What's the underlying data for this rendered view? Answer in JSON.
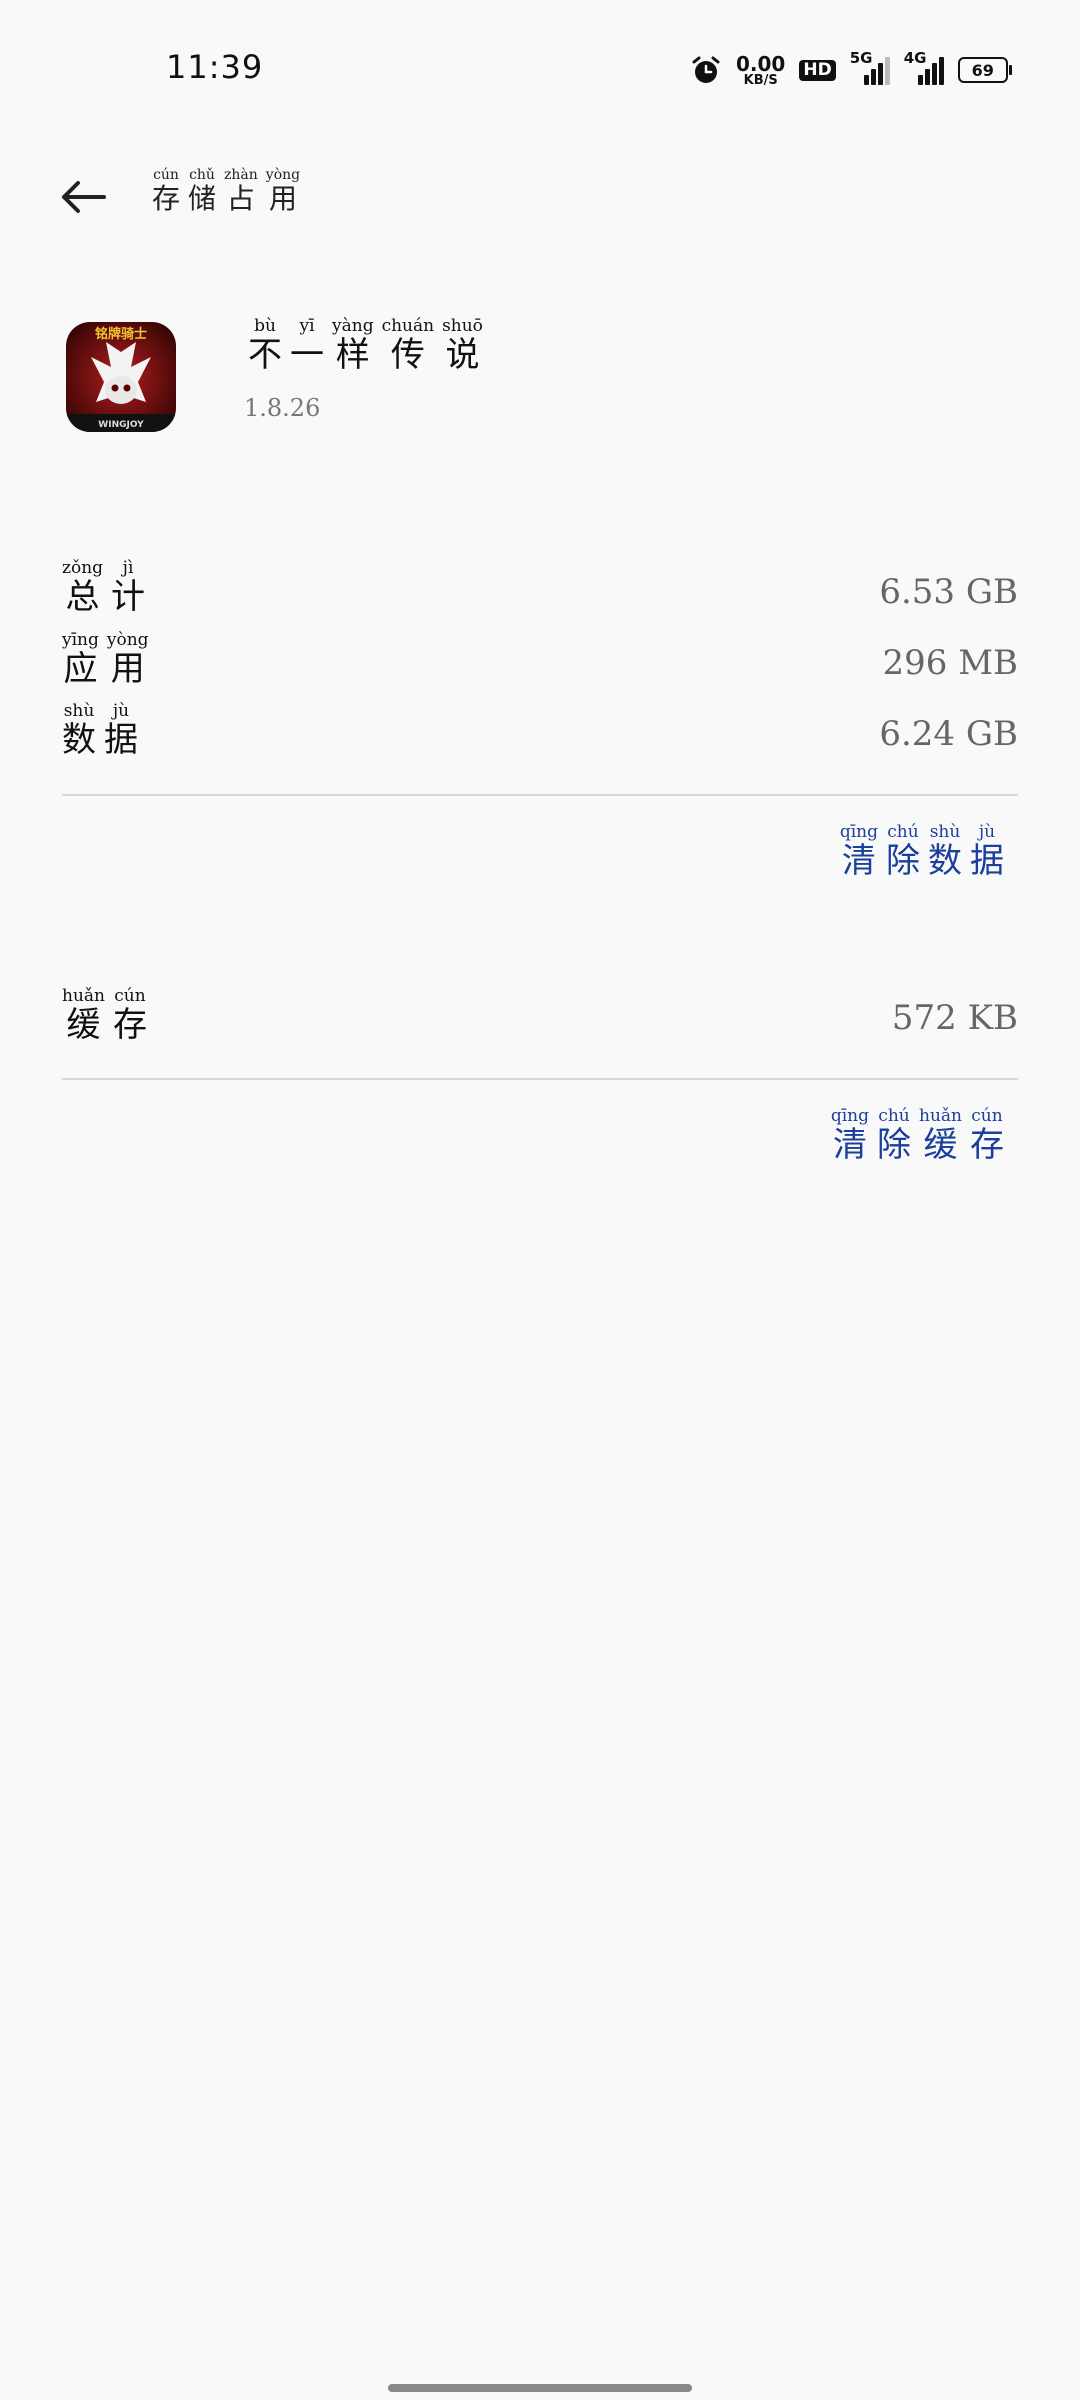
{
  "status_bar": {
    "time": "11:39",
    "net_speed_value": "0.00",
    "net_speed_unit": "KB/S",
    "hd_label": "HD",
    "signal1_label": "5G",
    "signal2_label": "4G",
    "battery": "69"
  },
  "header": {
    "title_chars": [
      {
        "char": "存",
        "pinyin": "cún"
      },
      {
        "char": "储",
        "pinyin": "chǔ"
      },
      {
        "char": "占",
        "pinyin": "zhàn"
      },
      {
        "char": "用",
        "pinyin": "yòng"
      }
    ]
  },
  "app": {
    "name_chars": [
      {
        "char": "不",
        "pinyin": "bù"
      },
      {
        "char": "一",
        "pinyin": "yī"
      },
      {
        "char": "样",
        "pinyin": "yàng"
      },
      {
        "char": "传",
        "pinyin": "chuán"
      },
      {
        "char": "说",
        "pinyin": "shuō"
      }
    ],
    "version": "1.8.26",
    "icon_text_top": "铭牌骑士",
    "icon_text_bottom": "WINGJOY"
  },
  "storage": {
    "total": {
      "label_chars": [
        {
          "char": "总",
          "pinyin": "zǒng"
        },
        {
          "char": "计",
          "pinyin": "jì"
        }
      ],
      "value": "6.53 GB"
    },
    "app": {
      "label_chars": [
        {
          "char": "应",
          "pinyin": "yīng"
        },
        {
          "char": "用",
          "pinyin": "yòng"
        }
      ],
      "value": "296 MB"
    },
    "data": {
      "label_chars": [
        {
          "char": "数",
          "pinyin": "shù"
        },
        {
          "char": "据",
          "pinyin": "jù"
        }
      ],
      "value": "6.24 GB"
    },
    "clear_data_chars": [
      {
        "char": "清",
        "pinyin": "qīng"
      },
      {
        "char": "除",
        "pinyin": "chú"
      },
      {
        "char": "数",
        "pinyin": "shù"
      },
      {
        "char": "据",
        "pinyin": "jù"
      }
    ]
  },
  "cache": {
    "label_chars": [
      {
        "char": "缓",
        "pinyin": "huǎn"
      },
      {
        "char": "存",
        "pinyin": "cún"
      }
    ],
    "value": "572 KB",
    "clear_cache_chars": [
      {
        "char": "清",
        "pinyin": "qīng"
      },
      {
        "char": "除",
        "pinyin": "chú"
      },
      {
        "char": "缓",
        "pinyin": "huǎn"
      },
      {
        "char": "存",
        "pinyin": "cún"
      }
    ]
  },
  "colors": {
    "accent": "#1a3f9c",
    "background": "#f9f9f9",
    "divider": "#d8d8d8"
  }
}
